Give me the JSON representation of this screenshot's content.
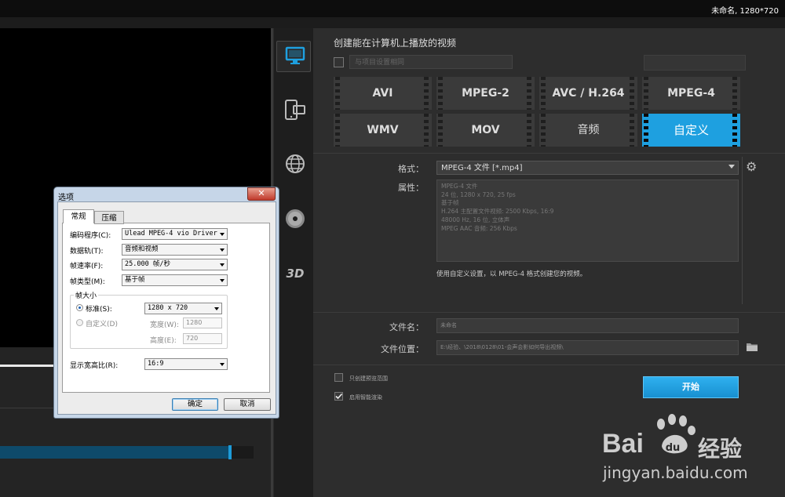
{
  "window": {
    "project_info": "未命名, 1280*720"
  },
  "sidebar": {
    "icons": [
      "monitor-icon",
      "mobile-device-icon",
      "globe-icon",
      "disc-icon",
      "3d-icon"
    ],
    "three_d_label": "3D"
  },
  "panel": {
    "header": "创建能在计算机上播放的视频",
    "same_as_project_label": "与项目设置相同",
    "same_as_project_checked": false,
    "formats": [
      "AVI",
      "MPEG-2",
      "AVC / H.264",
      "MPEG-4",
      "WMV",
      "MOV",
      "音频",
      "自定义"
    ],
    "selected_format": "自定义",
    "format_label": "格式：",
    "format_value": "MPEG-4 文件 [*.mp4]",
    "properties_label": "属性：",
    "properties": [
      "MPEG-4 文件",
      "24 位, 1280 x 720, 25 fps",
      "基于帧",
      "H.264 主配置文件视频: 2500 Kbps, 16:9",
      "48000 Hz, 16 位, 立体声",
      "MPEG AAC 音频: 256 Kbps"
    ],
    "description": "使用自定义设置，以 MPEG-4 格式创建您的视频。",
    "filename_label": "文件名：",
    "filename_value": "未命名",
    "filepath_label": "文件位置：",
    "filepath_value": "E:\\经验、\\2018\\0128\\01-会声会影如何导出视频\\",
    "option_preview_range": "只创建预览范围",
    "option_preview_range_checked": false,
    "option_smart_render": "启用智能渲染",
    "option_smart_render_checked": true,
    "start_button": "开始"
  },
  "dialog": {
    "title": "选项",
    "close": "✕",
    "tabs": [
      "常规",
      "压缩"
    ],
    "active_tab": "常规",
    "encoder_label": "编码程序(C):",
    "encoder_value": "Ulead MPEG-4 vio Driver",
    "track_label": "数据轨(T):",
    "track_value": "音频和视频",
    "framerate_label": "帧速率(F):",
    "framerate_value": "25.000 帧/秒",
    "frametype_label": "帧类型(M):",
    "frametype_value": "基于帧",
    "framesize_group": "帧大小",
    "standard_label": "标准(S):",
    "standard_value": "1280 x 720",
    "custom_label": "自定义(D)",
    "width_label": "宽度(W):",
    "width_value": "1280",
    "height_label": "高度(E):",
    "height_value": "720",
    "aspect_label": "显示宽高比(R):",
    "aspect_value": "16:9",
    "ok": "确定",
    "cancel": "取消"
  },
  "watermark": {
    "brand": "Bai",
    "brand_cn": "经验",
    "url": "jingyan.baidu.com"
  },
  "colors": {
    "accent": "#1ea0e0",
    "panel": "#2d2d2d",
    "dialog_frame": "#c6d6e8"
  }
}
